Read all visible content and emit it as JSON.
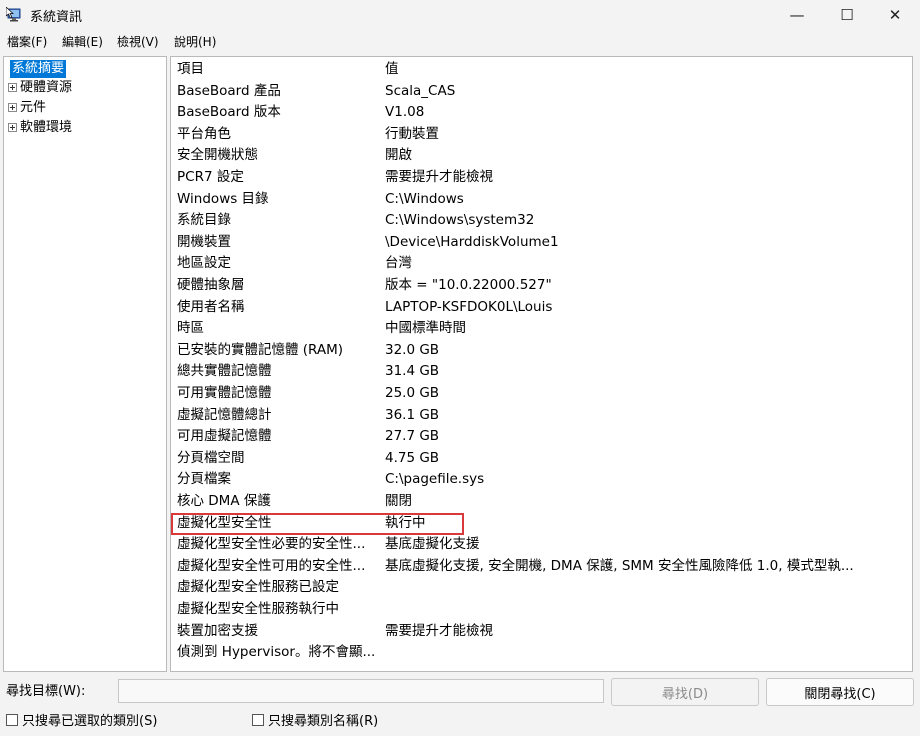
{
  "window": {
    "title": "系統資訊",
    "minimize": "—",
    "maximize": "☐",
    "close": "✕"
  },
  "menu": [
    "檔案(F)",
    "編輯(E)",
    "檢視(V)",
    "說明(H)"
  ],
  "tree": {
    "items": [
      {
        "label": "系統摘要",
        "selected": true
      },
      {
        "label": "硬體資源"
      },
      {
        "label": "元件"
      },
      {
        "label": "軟體環境"
      }
    ]
  },
  "list": {
    "headers": [
      "項目",
      "值"
    ],
    "rows": [
      [
        "BaseBoard 產品",
        "Scala_CAS"
      ],
      [
        "BaseBoard 版本",
        "V1.08"
      ],
      [
        "平台角色",
        "行動裝置"
      ],
      [
        "安全開機狀態",
        "開啟"
      ],
      [
        "PCR7 設定",
        "需要提升才能檢視"
      ],
      [
        "Windows 目錄",
        "C:\\Windows"
      ],
      [
        "系統目錄",
        "C:\\Windows\\system32"
      ],
      [
        "開機裝置",
        "\\Device\\HarddiskVolume1"
      ],
      [
        "地區設定",
        "台灣"
      ],
      [
        "硬體抽象層",
        "版本 = \"10.0.22000.527\""
      ],
      [
        "使用者名稱",
        "LAPTOP-KSFDOK0L\\Louis"
      ],
      [
        "時區",
        "中國標準時間"
      ],
      [
        "已安裝的實體記憶體 (RAM)",
        "32.0 GB"
      ],
      [
        "總共實體記憶體",
        "31.4 GB"
      ],
      [
        "可用實體記憶體",
        "25.0 GB"
      ],
      [
        "虛擬記憶體總計",
        "36.1 GB"
      ],
      [
        "可用虛擬記憶體",
        "27.7 GB"
      ],
      [
        "分頁檔空間",
        "4.75 GB"
      ],
      [
        "分頁檔案",
        "C:\\pagefile.sys"
      ],
      [
        "核心 DMA 保護",
        "關閉"
      ],
      [
        "虛擬化型安全性",
        "執行中"
      ],
      [
        "虛擬化型安全性必要的安全性...",
        "基底虛擬化支援"
      ],
      [
        "虛擬化型安全性可用的安全性...",
        "基底虛擬化支援, 安全開機, DMA 保護, SMM 安全性風險降低 1.0, 模式型執..."
      ],
      [
        "虛擬化型安全性服務已設定",
        ""
      ],
      [
        "虛擬化型安全性服務執行中",
        ""
      ],
      [
        "裝置加密支援",
        "需要提升才能檢視"
      ],
      [
        "偵測到 Hypervisor。將不會顯...",
        ""
      ]
    ],
    "highlight_row": 20
  },
  "find": {
    "label": "尋找目標(W):",
    "value": "",
    "find_button": "尋找(D)",
    "close_find_button": "關閉尋找(C)",
    "chk_selected_category": "只搜尋已選取的類別(S)",
    "chk_category_names": "只搜尋類別名稱(R)"
  },
  "colors": {
    "selection": "#0078d7",
    "highlight_border": "#d9393a"
  }
}
